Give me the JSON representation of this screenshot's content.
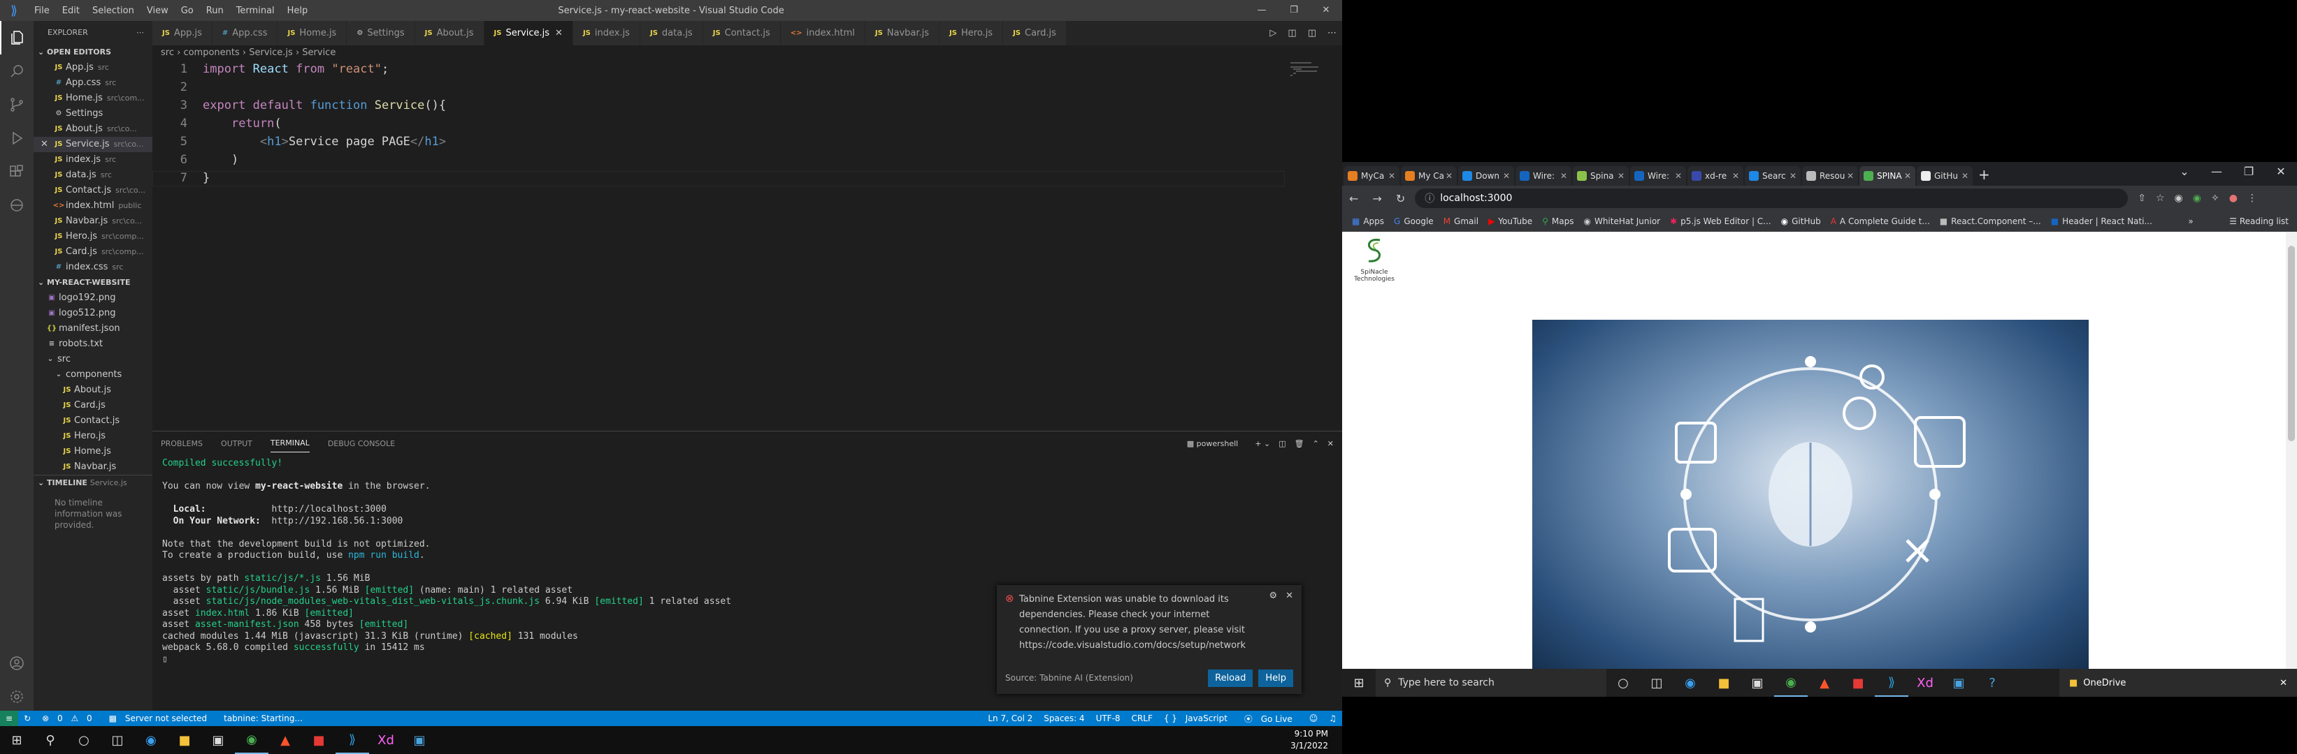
{
  "vscode": {
    "window_title": "Service.js - my-react-website - Visual Studio Code",
    "menu": [
      "File",
      "Edit",
      "Selection",
      "View",
      "Go",
      "Run",
      "Terminal",
      "Help"
    ],
    "explorer_title": "EXPLORER",
    "open_editors_title": "OPEN EDITORS",
    "open_editors": [
      {
        "name": "App.js",
        "desc": "src",
        "type": "js"
      },
      {
        "name": "App.css",
        "desc": "src",
        "type": "css"
      },
      {
        "name": "Home.js",
        "desc": "src\\com...",
        "type": "js"
      },
      {
        "name": "Settings",
        "desc": "",
        "type": "gear"
      },
      {
        "name": "About.js",
        "desc": "src\\co...",
        "type": "js"
      },
      {
        "name": "Service.js",
        "desc": "src\\co...",
        "type": "js",
        "active": true
      },
      {
        "name": "index.js",
        "desc": "src",
        "type": "js"
      },
      {
        "name": "data.js",
        "desc": "src",
        "type": "js"
      },
      {
        "name": "Contact.js",
        "desc": "src\\co...",
        "type": "js"
      },
      {
        "name": "index.html",
        "desc": "public",
        "type": "html"
      },
      {
        "name": "Navbar.js",
        "desc": "src\\co...",
        "type": "js"
      },
      {
        "name": "Hero.js",
        "desc": "src\\comp...",
        "type": "js"
      },
      {
        "name": "Card.js",
        "desc": "src\\comp...",
        "type": "js"
      },
      {
        "name": "index.css",
        "desc": "src",
        "type": "css"
      }
    ],
    "project_title": "MY-REACT-WEBSITE",
    "public_files": [
      {
        "name": "logo192.png",
        "type": "png"
      },
      {
        "name": "logo512.png",
        "type": "png"
      },
      {
        "name": "manifest.json",
        "type": "json"
      },
      {
        "name": "robots.txt",
        "type": "txt"
      }
    ],
    "src_folder": "src",
    "components_folder": "components",
    "component_files": [
      "About.js",
      "Card.js",
      "Contact.js",
      "Hero.js",
      "Home.js",
      "Navbar.js"
    ],
    "timeline_title": "TIMELINE",
    "timeline_file": "Service.js",
    "timeline_empty": "No timeline information was provided.",
    "tabs": [
      {
        "name": "App.js",
        "type": "js"
      },
      {
        "name": "App.css",
        "type": "css"
      },
      {
        "name": "Home.js",
        "type": "js"
      },
      {
        "name": "Settings",
        "type": "gear"
      },
      {
        "name": "About.js",
        "type": "js"
      },
      {
        "name": "Service.js",
        "type": "js",
        "active": true
      },
      {
        "name": "index.js",
        "type": "js"
      },
      {
        "name": "data.js",
        "type": "js"
      },
      {
        "name": "Contact.js",
        "type": "js"
      },
      {
        "name": "index.html",
        "type": "html"
      },
      {
        "name": "Navbar.js",
        "type": "js"
      },
      {
        "name": "Hero.js",
        "type": "js"
      },
      {
        "name": "Card.js",
        "type": "js"
      }
    ],
    "breadcrumb": [
      "src",
      "components",
      "Service.js",
      "Service"
    ],
    "code_lines": [
      "1",
      "2",
      "3",
      "4",
      "5",
      "6",
      "7"
    ],
    "panel_tabs": [
      "PROBLEMS",
      "OUTPUT",
      "TERMINAL",
      "DEBUG CONSOLE"
    ],
    "panel_active": "TERMINAL",
    "terminal_shell": "powershell",
    "terminal": {
      "compiled": "Compiled successfully!",
      "view_pre": "You can now view ",
      "app_name": "my-react-website",
      "view_post": " in the browser.",
      "local_label": "  Local:",
      "local_url": "http://localhost:3000",
      "network_label": "  On Your Network:",
      "network_url": "http://192.168.56.1:3000",
      "note1": "Note that the development build is not optimized.",
      "note2_pre": "To create a production build, use ",
      "note2_cmd": "npm run build",
      "note2_post": ".",
      "assets1_pre": "assets by path ",
      "assets1_path": "static/js/*.js",
      "assets1_post": " 1.56 MiB",
      "asset2_pre": "  asset ",
      "asset2_name": "static/js/bundle.js",
      "asset2_size": " 1.56 MiB ",
      "asset2_emit": "[emitted]",
      "asset2_post": " (name: main) 1 related asset",
      "asset3_pre": "  asset ",
      "asset3_name": "static/js/node_modules_web-vitals_dist_web-vitals_js.chunk.js",
      "asset3_size": " 6.94 KiB ",
      "asset3_emit": "[emitted]",
      "asset3_post": " 1 related asset",
      "asset4_pre": "asset ",
      "asset4_name": "index.html",
      "asset4_size": " 1.86 KiB ",
      "asset4_emit": "[emitted]",
      "asset5_pre": "asset ",
      "asset5_name": "asset-manifest.json",
      "asset5_size": " 458 bytes ",
      "asset5_emit": "[emitted]",
      "cached_pre": "cached modules 1.44 MiB (javascript) 31.3 KiB (runtime) ",
      "cached_tag": "[cached]",
      "cached_post": " 131 modules",
      "webpack_pre": "webpack 5.68.0 compiled ",
      "webpack_ok": "successfully",
      "webpack_post": " in 15412 ms"
    },
    "notification": {
      "message": "Tabnine Extension was unable to download its dependencies. Please check your internet connection. If you use a proxy server, please visit https://code.visualstudio.com/docs/setup/network",
      "source": "Source: Tabnine AI (Extension)",
      "reload": "Reload",
      "help": "Help"
    },
    "status": {
      "errors": "0",
      "warnings": "0",
      "server": "Server not selected",
      "tabnine": "tabnine: Starting...",
      "position": "Ln 7, Col 2",
      "spaces": "Spaces: 4",
      "encoding": "UTF-8",
      "eol": "CRLF",
      "lang": "JavaScript",
      "golive": "Go Live"
    },
    "clock_time": "9:10 PM",
    "clock_date": "3/1/2022"
  },
  "browser": {
    "tabs": [
      "MyCa",
      "My Ca",
      "Down",
      "Wire:",
      "Spina",
      "Wire:",
      "xd-re",
      "Searc",
      "Resou",
      "SPINA",
      "GitHu"
    ],
    "active_tab": 9,
    "url": "localhost:3000",
    "bookmarks": [
      "Apps",
      "Google",
      "Gmail",
      "YouTube",
      "Maps",
      "WhiteHat Junior",
      "p5.js Web Editor | C...",
      "GitHub",
      "A Complete Guide t...",
      "React.Component –...",
      "Header | React Nati..."
    ],
    "reading_list": "Reading list",
    "logo_text": "SpiNacle Technologies",
    "taskbar_search": "Type here to search",
    "onedrive": "OneDrive"
  },
  "colors": {
    "accent": "#007acc",
    "terminal_green": "#23d18b",
    "terminal_cyan": "#29b8db",
    "error": "#f14c4c"
  }
}
